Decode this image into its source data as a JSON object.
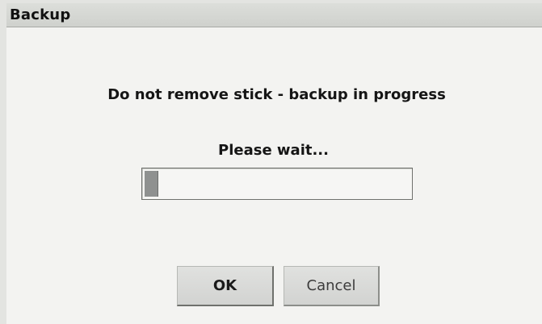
{
  "dialog": {
    "title": "Backup",
    "message": "Do not remove stick - backup in progress",
    "status": "Please wait...",
    "progress": 0.05,
    "buttons": {
      "ok_label": "OK",
      "cancel_label": "Cancel"
    }
  }
}
